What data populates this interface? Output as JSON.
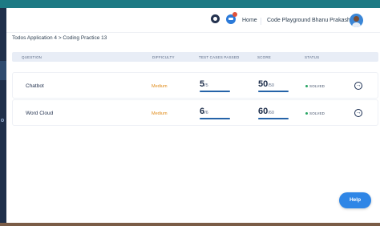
{
  "header": {
    "nav_home": "Home",
    "nav_playground": "Code Playground",
    "user_name": "Bhanu Prakash"
  },
  "breadcrumb": "Todos Application 4 > Coding Practice 13",
  "table": {
    "columns": [
      "QUESTION",
      "DIFFICULTY",
      "TEST CASES PASSED",
      "SCORE",
      "STATUS"
    ],
    "rows": [
      {
        "question": "Chatbot",
        "difficulty": "Medium",
        "tests_passed": "5",
        "tests_total": "/5",
        "tests_fraction": 1.0,
        "score": "50",
        "score_total": "/50",
        "score_fraction": 1.0,
        "status": "SOLVED"
      },
      {
        "question": "Word Cloud",
        "difficulty": "Medium",
        "tests_passed": "6",
        "tests_total": "/6",
        "tests_fraction": 1.0,
        "score": "60",
        "score_total": "/60",
        "score_fraction": 1.0,
        "status": "SOLVED"
      }
    ]
  },
  "help_label": "Help",
  "colors": {
    "accent": "#2f86e6",
    "difficulty_medium": "#e08a17",
    "solved": "#27a462",
    "progress": "#2563a8"
  }
}
